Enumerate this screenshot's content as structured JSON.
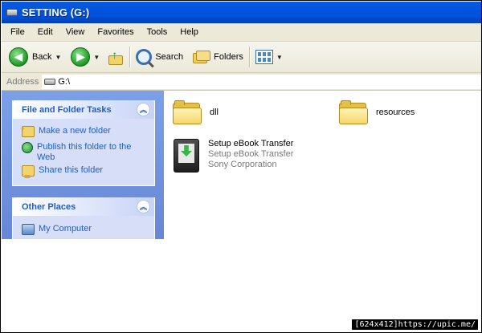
{
  "window": {
    "title": "SETTING (G:)"
  },
  "menu": [
    "File",
    "Edit",
    "View",
    "Favorites",
    "Tools",
    "Help"
  ],
  "toolbar": {
    "back": "Back",
    "search": "Search",
    "folders": "Folders"
  },
  "address": {
    "label": "Address",
    "value": "G:\\"
  },
  "tasks": {
    "header": "File and Folder Tasks",
    "items": [
      "Make a new folder",
      "Publish this folder to the Web",
      "Share this folder"
    ]
  },
  "places": {
    "header": "Other Places",
    "items": [
      "My Computer"
    ]
  },
  "files": [
    {
      "name": "dll"
    },
    {
      "name": "resources"
    },
    {
      "name": "Setup eBook Transfer",
      "line2": "Setup eBook Transfer",
      "line3": "Sony Corporation"
    }
  ],
  "watermark": "[624x412]https://upic.me/"
}
